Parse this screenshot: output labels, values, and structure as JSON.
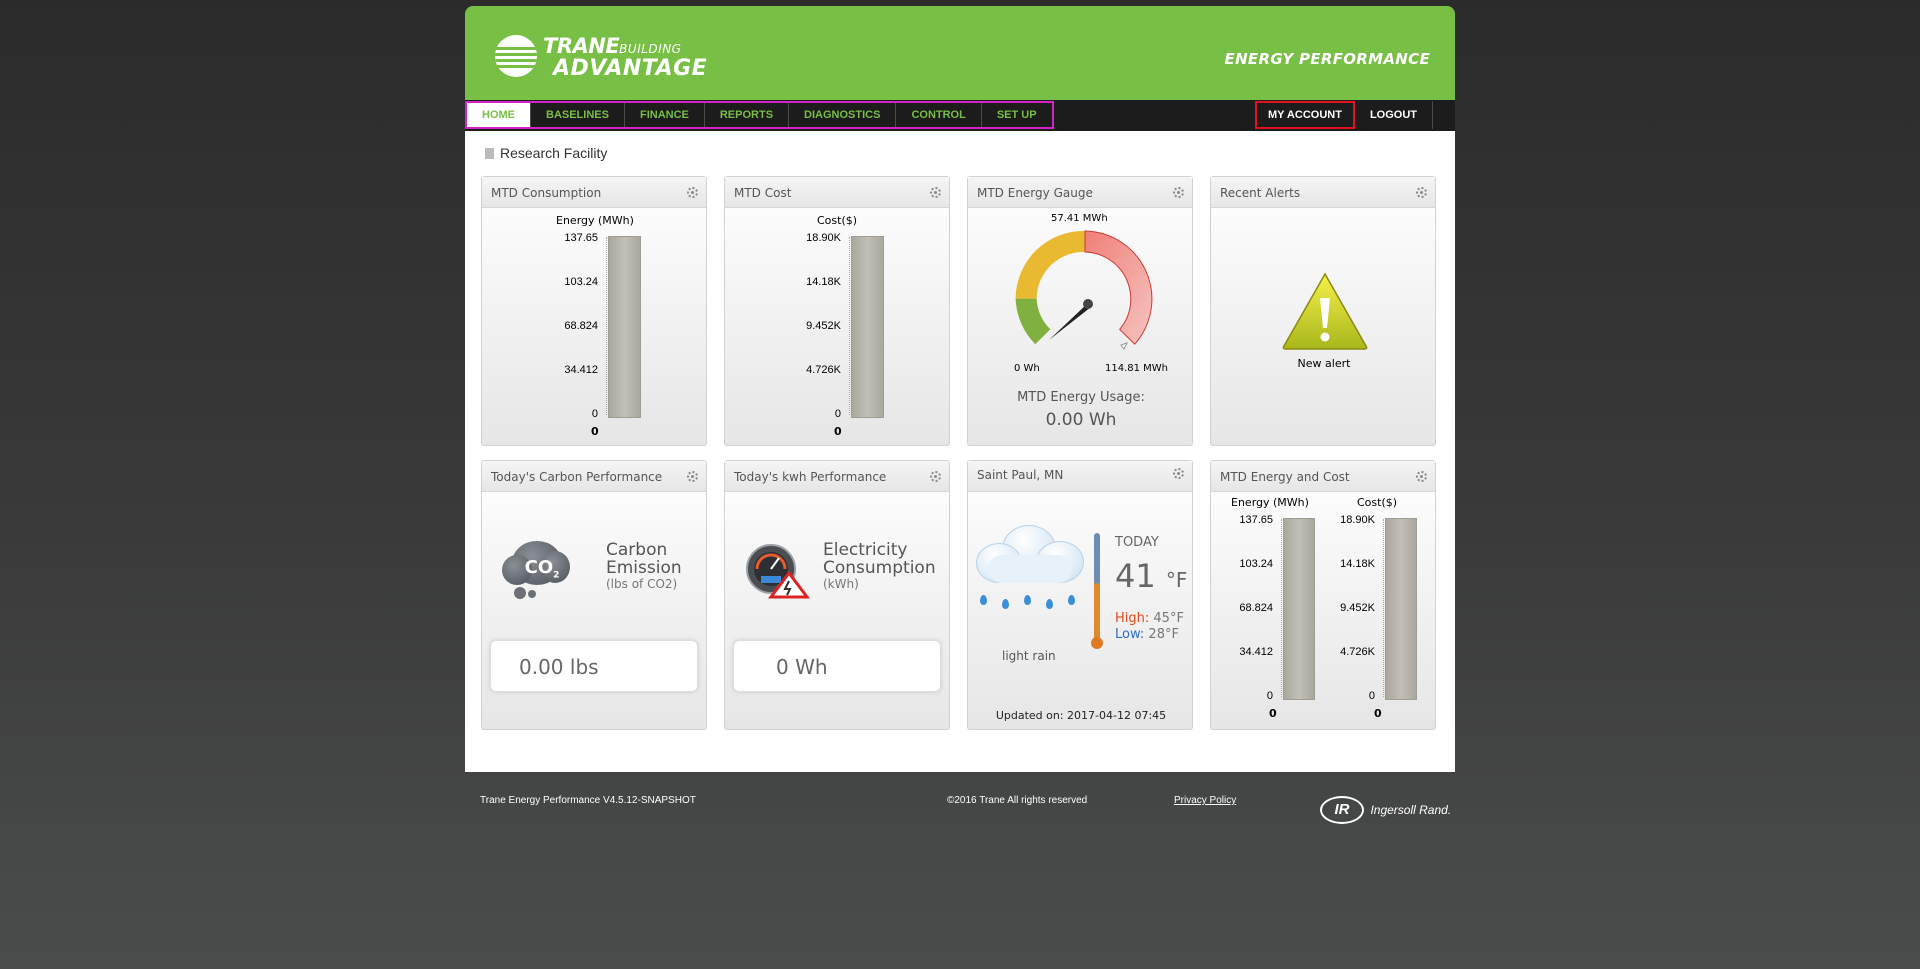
{
  "header": {
    "logo_line1": "TRANE",
    "logo_line1_small": "BUILDING",
    "logo_line2": "ADVANTAGE",
    "title": "ENERGY PERFORMANCE"
  },
  "nav": {
    "items": [
      "HOME",
      "BASELINES",
      "FINANCE",
      "REPORTS",
      "DIAGNOSTICS",
      "CONTROL",
      "SET UP"
    ],
    "active": "HOME",
    "my_account": "MY ACCOUNT",
    "logout": "LOGOUT"
  },
  "facility": "Research Facility",
  "widgets": {
    "mtd_consumption": {
      "title": "MTD Consumption",
      "axis_label": "Energy (MWh)",
      "ticks": [
        "137.65",
        "103.24",
        "68.824",
        "34.412",
        "0"
      ],
      "value": "0"
    },
    "mtd_cost": {
      "title": "MTD Cost",
      "axis_label": "Cost($)",
      "ticks": [
        "18.90K",
        "14.18K",
        "9.452K",
        "4.726K",
        "0"
      ],
      "value": "0"
    },
    "mtd_gauge": {
      "title": "MTD Energy Gauge",
      "top_label": "57.41 MWh",
      "min_label": "0 Wh",
      "max_label": "114.81 MWh",
      "usage_label": "MTD Energy Usage:",
      "usage_value": "0.00 Wh"
    },
    "recent_alerts": {
      "title": "Recent Alerts",
      "alert_text": "New alert"
    },
    "carbon": {
      "title": "Today's Carbon Performance",
      "icon_text": "CO",
      "icon_sub": "2",
      "label1": "Carbon",
      "label2": "Emission",
      "sub": "(lbs of CO2)",
      "value": "0.00 lbs"
    },
    "kwh": {
      "title": "Today's kwh Performance",
      "label1": "Electricity",
      "label2": "Consumption",
      "sub": "(kWh)",
      "value": "0 Wh"
    },
    "weather": {
      "title": "Saint Paul, MN",
      "today": "TODAY",
      "temp": "41",
      "unit": "°F",
      "high_label": "High:",
      "high": "45°F",
      "low_label": "Low:",
      "low": "28°F",
      "condition": "light rain",
      "updated": "Updated on: 2017-04-12 07:45"
    },
    "mtd_energy_cost": {
      "title": "MTD Energy and Cost",
      "energy_label": "Energy (MWh)",
      "cost_label": "Cost($)",
      "energy_ticks": [
        "137.65",
        "103.24",
        "68.824",
        "34.412",
        "0"
      ],
      "cost_ticks": [
        "18.90K",
        "14.18K",
        "9.452K",
        "4.726K",
        "0"
      ],
      "energy_value": "0",
      "cost_value": "0"
    }
  },
  "footer": {
    "version": "Trane Energy Performance V4.5.12-SNAPSHOT",
    "copyright": "©2016 Trane All rights reserved",
    "privacy": "Privacy Policy",
    "brand": "Ingersoll Rand."
  },
  "colors": {
    "brand_green": "#78bf45",
    "nav_dark": "#1c1c1c",
    "nav_highlight": "#d322c8",
    "account_highlight": "#e0141e"
  }
}
